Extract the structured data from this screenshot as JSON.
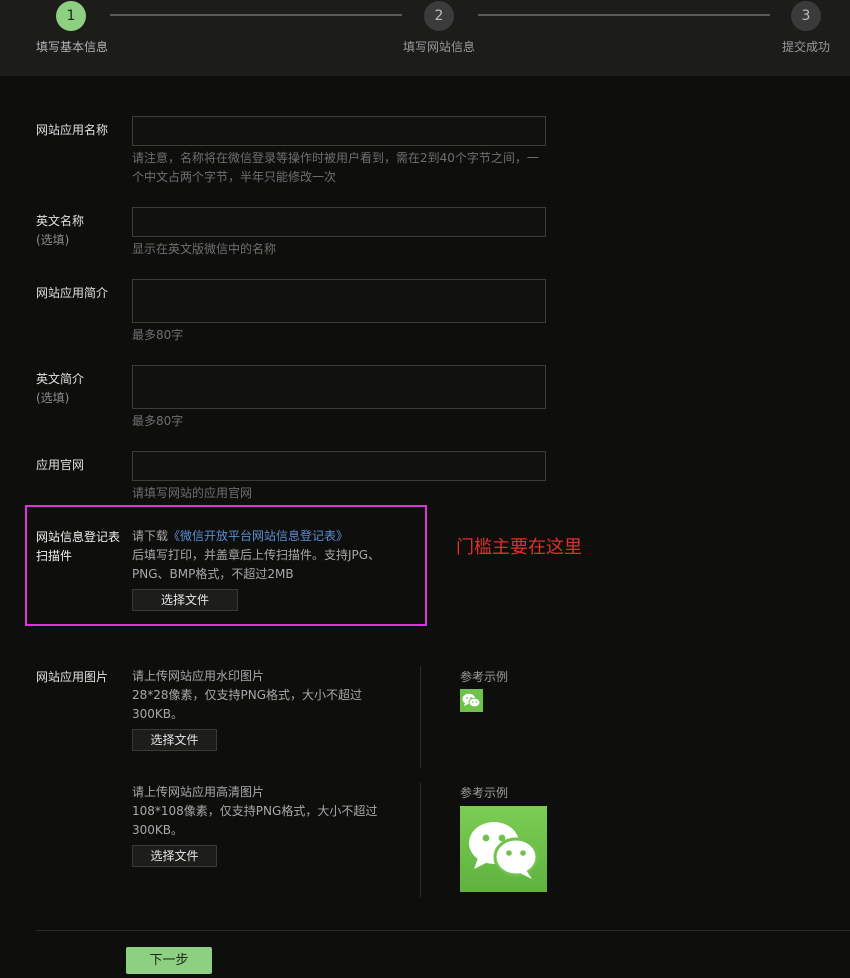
{
  "stepper": {
    "steps": [
      {
        "number": "1",
        "label": "填写基本信息"
      },
      {
        "number": "2",
        "label": "填写网站信息"
      },
      {
        "number": "3",
        "label": "提交成功"
      }
    ]
  },
  "form": {
    "app_name": {
      "label": "网站应用名称",
      "hint_line1": "请注意，名称将在微信登录等操作时被用户看到，需在2到40个字节之间，一",
      "hint_line2": "个中文占两个字节，半年只能修改一次"
    },
    "english_name": {
      "label": "英文名称",
      "optional": "(选填)",
      "hint": "显示在英文版微信中的名称"
    },
    "app_intro": {
      "label": "网站应用简介",
      "hint": "最多80字"
    },
    "english_intro": {
      "label": "英文简介",
      "optional": "(选填)",
      "hint": "最多80字"
    },
    "website": {
      "label": "应用官网",
      "hint": "请填写网站的应用官网"
    },
    "registration_form": {
      "label_line1": "网站信息登记表",
      "label_line2": "扫描件",
      "download_prefix": "请下载",
      "download_link": "《微信开放平台网站信息登记表》",
      "desc_line1": "后填写打印，并盖章后上传扫描件。支持JPG、",
      "desc_line2": "PNG、BMP格式，不超过2MB",
      "button": "选择文件"
    },
    "app_images": {
      "label": "网站应用图片",
      "small": {
        "line1": "请上传网站应用水印图片",
        "line2": "28*28像素，仅支持PNG格式，大小不超过",
        "line3": "300KB。",
        "button": "选择文件",
        "ref_label": "参考示例"
      },
      "large": {
        "line1": "请上传网站应用高清图片",
        "line2": "108*108像素，仅支持PNG格式，大小不超过",
        "line3": "300KB。",
        "button": "选择文件",
        "ref_label": "参考示例"
      }
    },
    "next_button": "下一步"
  },
  "annotation": "门槛主要在这里",
  "colors": {
    "accent_green": "#8ed081",
    "highlight_border": "#e030e0",
    "annotation_red": "#e0302c",
    "link_blue": "#5a8fd6",
    "wechat_green": "#6fc24a"
  }
}
